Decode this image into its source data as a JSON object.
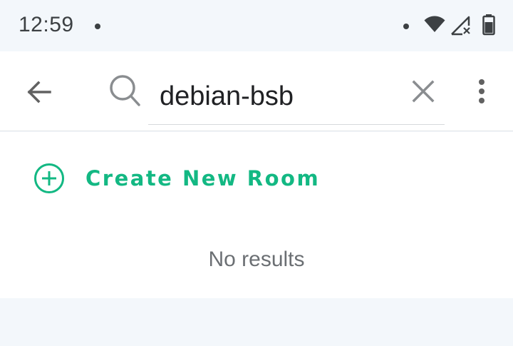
{
  "status_bar": {
    "time": "12:59",
    "icons": [
      "notification-dot-icon",
      "notification-dot-icon",
      "wifi-icon",
      "cell-signal-no-data-icon",
      "battery-icon"
    ]
  },
  "toolbar": {
    "back_icon": "arrow-back-icon",
    "search_icon": "search-icon",
    "clear_icon": "close-icon",
    "overflow_icon": "more-vertical-icon"
  },
  "search": {
    "value": "debian-bsb",
    "placeholder": ""
  },
  "actions": {
    "create_room_label": "Create New Room",
    "create_room_icon": "add-circle-outline-icon"
  },
  "results": {
    "empty_text": "No results"
  },
  "colors": {
    "accent": "#13b883",
    "status_bar_bg": "#f3f7fb",
    "toolbar_bg": "#ffffff",
    "text_primary": "#202124",
    "text_secondary": "#6b6f73",
    "icon_gray": "#757575"
  }
}
